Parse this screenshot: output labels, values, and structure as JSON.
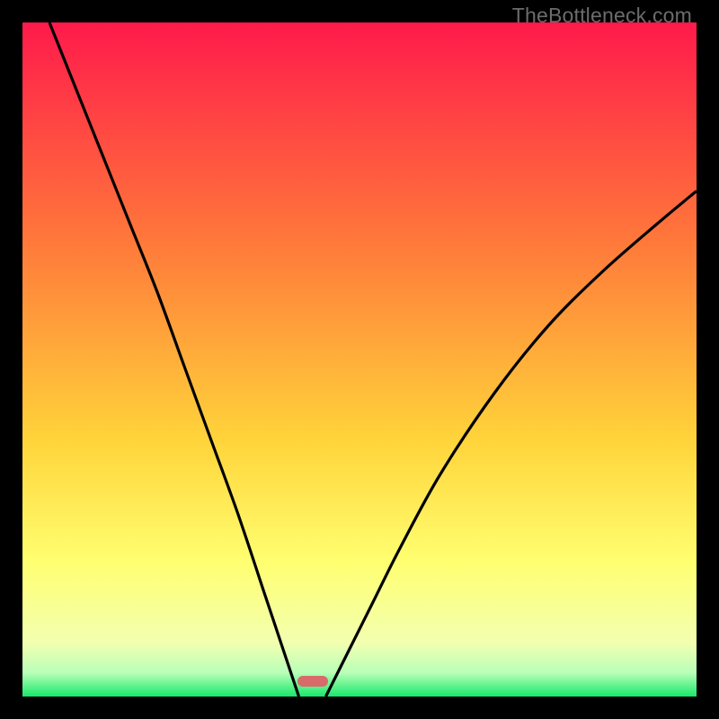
{
  "watermark": {
    "text": "TheBottleneck.com"
  },
  "chart_data": {
    "type": "line",
    "title": "",
    "xlabel": "",
    "ylabel": "",
    "xlim": [
      0,
      100
    ],
    "ylim": [
      0,
      100
    ],
    "grid": false,
    "legend": false,
    "gradient_stops": [
      {
        "offset": 0,
        "color": "#ff1a4b"
      },
      {
        "offset": 0.33,
        "color": "#ff7a3a"
      },
      {
        "offset": 0.62,
        "color": "#ffd43a"
      },
      {
        "offset": 0.8,
        "color": "#ffff70"
      },
      {
        "offset": 0.92,
        "color": "#f3ffb0"
      },
      {
        "offset": 0.965,
        "color": "#b8ffb8"
      },
      {
        "offset": 1.0,
        "color": "#17e86a"
      }
    ],
    "series": [
      {
        "name": "left-branch",
        "x": [
          4,
          8,
          12,
          16,
          20,
          24,
          28,
          32,
          36,
          38,
          40,
          41
        ],
        "y": [
          100,
          90,
          80,
          70,
          60,
          49,
          38,
          27,
          15,
          9,
          3,
          0
        ]
      },
      {
        "name": "right-branch",
        "x": [
          45,
          48,
          52,
          56,
          62,
          70,
          78,
          86,
          94,
          100
        ],
        "y": [
          0,
          6,
          14,
          22,
          33,
          45,
          55,
          63,
          70,
          75
        ]
      }
    ],
    "marker": {
      "x": 43,
      "y": 2.3,
      "color": "#d96a6a"
    }
  }
}
